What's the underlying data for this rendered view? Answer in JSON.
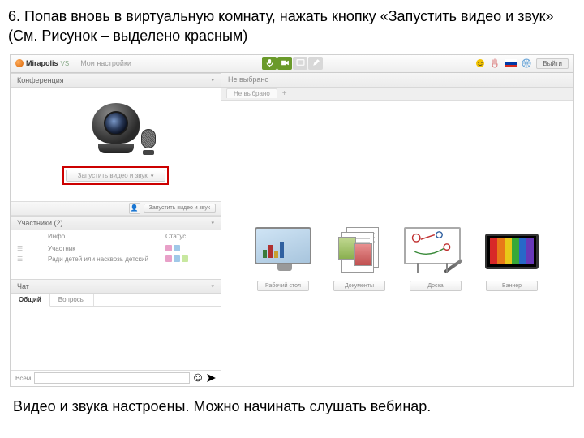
{
  "instruction": "6. Попав вновь в виртуальную комнату, нажать кнопку «Запустить видео и звук» (См. Рисунок – выделено красным)",
  "conclusion": "Видео и звука настроены. Можно начинать  слушать вебинар.",
  "topbar": {
    "brand": "Mirapolis",
    "brand_suffix": "VS",
    "breadcrumb": "Мои настройки",
    "exit": "Выйти"
  },
  "left": {
    "conference_title": "Конференция",
    "launch_button": "Запустить видео и звук",
    "sub_button": "Запустить видео и звук",
    "participants_title": "Участники (2)",
    "col_info": "Инфо",
    "col_status": "Статус",
    "row1": "Участник",
    "row2": "Ради детей или насквозь детский",
    "chat_title": "Чат",
    "tab_general": "Общий",
    "tab_questions": "Вопросы",
    "chat_to": "Всем"
  },
  "right": {
    "header": "Не выбрано",
    "tab": "Не выбрано",
    "cards": {
      "desktop": "Рабочий стол",
      "documents": "Документы",
      "board": "Доска",
      "banner": "Баннер"
    }
  }
}
